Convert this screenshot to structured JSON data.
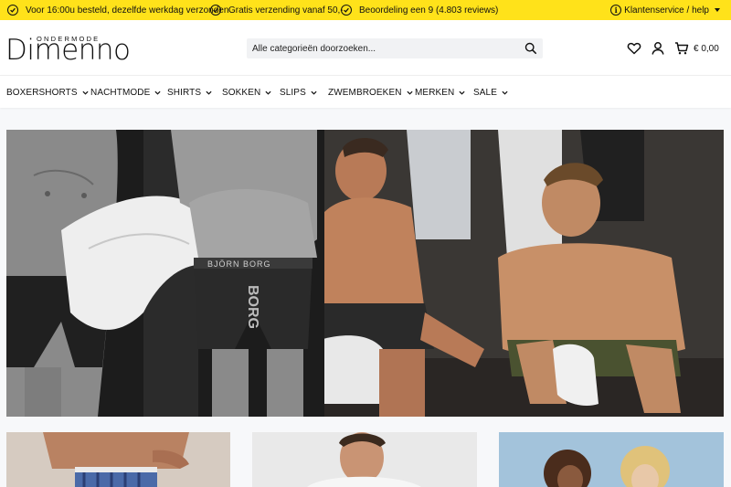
{
  "usp_bar": {
    "items": [
      {
        "text": "Voor 16:00u besteld, dezelfde werkdag verzonden"
      },
      {
        "text": "Gratis verzending vanaf 50,-"
      },
      {
        "text": "Beoordeling een 9 (4.803 reviews)"
      }
    ],
    "service_label": "Klantenservice / help",
    "background": "#ffe21a"
  },
  "header": {
    "logo_small": "ONDERMODE",
    "logo_big": "Dimenno",
    "search_placeholder": "Alle categorieën doorzoeken...",
    "cart_amount": "€ 0,00",
    "icons": [
      "heart-icon",
      "user-icon",
      "cart-icon"
    ]
  },
  "nav": {
    "items": [
      {
        "label": "BOXERSHORTS"
      },
      {
        "label": "NACHTMODE"
      },
      {
        "label": "SHIRTS"
      },
      {
        "label": "SOKKEN"
      },
      {
        "label": "SLIPS"
      },
      {
        "label": "ZWEMBROEKEN"
      },
      {
        "label": "MERKEN"
      },
      {
        "label": "SALE"
      }
    ]
  },
  "hero": {
    "brand_on_waistband": "BJÖRN BORG"
  }
}
